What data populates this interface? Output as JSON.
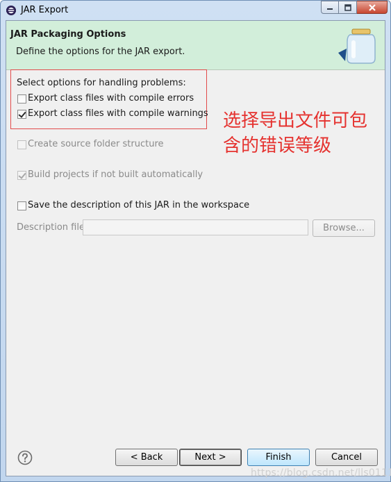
{
  "window": {
    "title": "JAR Export"
  },
  "banner": {
    "title": "JAR Packaging Options",
    "description": "Define the options for the JAR export."
  },
  "problems": {
    "heading": "Select options for handling problems:",
    "options": [
      {
        "label": "Export class files with compile errors",
        "checked": false
      },
      {
        "label": "Export class files with compile warnings",
        "checked": true
      }
    ]
  },
  "annotation": {
    "lines": [
      "选择导出文件可包",
      "含的错误等级"
    ]
  },
  "options": {
    "create_source_folder": {
      "label": "Create source folder structure",
      "checked": false,
      "enabled": false
    },
    "build_projects": {
      "label": "Build projects if not built automatically",
      "checked": true,
      "enabled": false
    },
    "save_description": {
      "label": "Save the description of this JAR in the workspace",
      "checked": false,
      "enabled": true
    }
  },
  "description_file": {
    "label": "Description file:",
    "value": "",
    "browse_label": "Browse..."
  },
  "footer": {
    "back_label": "< Back",
    "next_label": "Next >",
    "finish_label": "Finish",
    "cancel_label": "Cancel"
  },
  "watermark": "https://blog.csdn.net/lls0111",
  "colors": {
    "banner_bg": "#d2eeda",
    "annotation_red": "#e5322f",
    "highlight_border": "#e24a4a"
  }
}
